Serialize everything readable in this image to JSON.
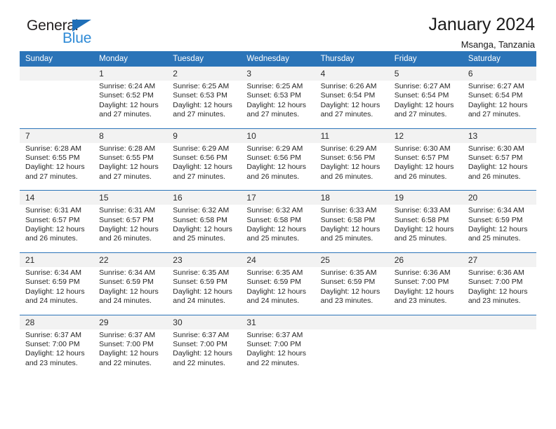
{
  "brand": {
    "name_part1": "General",
    "name_part2": "Blue",
    "triangle_icon": "triangle-icon",
    "accent_black": "#231f20",
    "accent_blue": "#2e8ad6"
  },
  "header": {
    "title": "January 2024",
    "subtitle": "Msanga, Tanzania"
  },
  "theme": {
    "header_blue": "#2b74b8",
    "daynum_band": "#f2f2f2",
    "text": "#262626"
  },
  "weekday_headers": [
    "Sunday",
    "Monday",
    "Tuesday",
    "Wednesday",
    "Thursday",
    "Friday",
    "Saturday"
  ],
  "weeks": [
    {
      "days": [
        {
          "num": "",
          "sunrise": "",
          "sunset": "",
          "daylight_line1": "",
          "daylight_line2": "",
          "empty": true
        },
        {
          "num": "1",
          "sunrise": "Sunrise: 6:24 AM",
          "sunset": "Sunset: 6:52 PM",
          "daylight_line1": "Daylight: 12 hours",
          "daylight_line2": "and 27 minutes.",
          "empty": false
        },
        {
          "num": "2",
          "sunrise": "Sunrise: 6:25 AM",
          "sunset": "Sunset: 6:53 PM",
          "daylight_line1": "Daylight: 12 hours",
          "daylight_line2": "and 27 minutes.",
          "empty": false
        },
        {
          "num": "3",
          "sunrise": "Sunrise: 6:25 AM",
          "sunset": "Sunset: 6:53 PM",
          "daylight_line1": "Daylight: 12 hours",
          "daylight_line2": "and 27 minutes.",
          "empty": false
        },
        {
          "num": "4",
          "sunrise": "Sunrise: 6:26 AM",
          "sunset": "Sunset: 6:54 PM",
          "daylight_line1": "Daylight: 12 hours",
          "daylight_line2": "and 27 minutes.",
          "empty": false
        },
        {
          "num": "5",
          "sunrise": "Sunrise: 6:27 AM",
          "sunset": "Sunset: 6:54 PM",
          "daylight_line1": "Daylight: 12 hours",
          "daylight_line2": "and 27 minutes.",
          "empty": false
        },
        {
          "num": "6",
          "sunrise": "Sunrise: 6:27 AM",
          "sunset": "Sunset: 6:54 PM",
          "daylight_line1": "Daylight: 12 hours",
          "daylight_line2": "and 27 minutes.",
          "empty": false
        }
      ]
    },
    {
      "days": [
        {
          "num": "7",
          "sunrise": "Sunrise: 6:28 AM",
          "sunset": "Sunset: 6:55 PM",
          "daylight_line1": "Daylight: 12 hours",
          "daylight_line2": "and 27 minutes.",
          "empty": false
        },
        {
          "num": "8",
          "sunrise": "Sunrise: 6:28 AM",
          "sunset": "Sunset: 6:55 PM",
          "daylight_line1": "Daylight: 12 hours",
          "daylight_line2": "and 27 minutes.",
          "empty": false
        },
        {
          "num": "9",
          "sunrise": "Sunrise: 6:29 AM",
          "sunset": "Sunset: 6:56 PM",
          "daylight_line1": "Daylight: 12 hours",
          "daylight_line2": "and 27 minutes.",
          "empty": false
        },
        {
          "num": "10",
          "sunrise": "Sunrise: 6:29 AM",
          "sunset": "Sunset: 6:56 PM",
          "daylight_line1": "Daylight: 12 hours",
          "daylight_line2": "and 26 minutes.",
          "empty": false
        },
        {
          "num": "11",
          "sunrise": "Sunrise: 6:29 AM",
          "sunset": "Sunset: 6:56 PM",
          "daylight_line1": "Daylight: 12 hours",
          "daylight_line2": "and 26 minutes.",
          "empty": false
        },
        {
          "num": "12",
          "sunrise": "Sunrise: 6:30 AM",
          "sunset": "Sunset: 6:57 PM",
          "daylight_line1": "Daylight: 12 hours",
          "daylight_line2": "and 26 minutes.",
          "empty": false
        },
        {
          "num": "13",
          "sunrise": "Sunrise: 6:30 AM",
          "sunset": "Sunset: 6:57 PM",
          "daylight_line1": "Daylight: 12 hours",
          "daylight_line2": "and 26 minutes.",
          "empty": false
        }
      ]
    },
    {
      "days": [
        {
          "num": "14",
          "sunrise": "Sunrise: 6:31 AM",
          "sunset": "Sunset: 6:57 PM",
          "daylight_line1": "Daylight: 12 hours",
          "daylight_line2": "and 26 minutes.",
          "empty": false
        },
        {
          "num": "15",
          "sunrise": "Sunrise: 6:31 AM",
          "sunset": "Sunset: 6:57 PM",
          "daylight_line1": "Daylight: 12 hours",
          "daylight_line2": "and 26 minutes.",
          "empty": false
        },
        {
          "num": "16",
          "sunrise": "Sunrise: 6:32 AM",
          "sunset": "Sunset: 6:58 PM",
          "daylight_line1": "Daylight: 12 hours",
          "daylight_line2": "and 25 minutes.",
          "empty": false
        },
        {
          "num": "17",
          "sunrise": "Sunrise: 6:32 AM",
          "sunset": "Sunset: 6:58 PM",
          "daylight_line1": "Daylight: 12 hours",
          "daylight_line2": "and 25 minutes.",
          "empty": false
        },
        {
          "num": "18",
          "sunrise": "Sunrise: 6:33 AM",
          "sunset": "Sunset: 6:58 PM",
          "daylight_line1": "Daylight: 12 hours",
          "daylight_line2": "and 25 minutes.",
          "empty": false
        },
        {
          "num": "19",
          "sunrise": "Sunrise: 6:33 AM",
          "sunset": "Sunset: 6:58 PM",
          "daylight_line1": "Daylight: 12 hours",
          "daylight_line2": "and 25 minutes.",
          "empty": false
        },
        {
          "num": "20",
          "sunrise": "Sunrise: 6:34 AM",
          "sunset": "Sunset: 6:59 PM",
          "daylight_line1": "Daylight: 12 hours",
          "daylight_line2": "and 25 minutes.",
          "empty": false
        }
      ]
    },
    {
      "days": [
        {
          "num": "21",
          "sunrise": "Sunrise: 6:34 AM",
          "sunset": "Sunset: 6:59 PM",
          "daylight_line1": "Daylight: 12 hours",
          "daylight_line2": "and 24 minutes.",
          "empty": false
        },
        {
          "num": "22",
          "sunrise": "Sunrise: 6:34 AM",
          "sunset": "Sunset: 6:59 PM",
          "daylight_line1": "Daylight: 12 hours",
          "daylight_line2": "and 24 minutes.",
          "empty": false
        },
        {
          "num": "23",
          "sunrise": "Sunrise: 6:35 AM",
          "sunset": "Sunset: 6:59 PM",
          "daylight_line1": "Daylight: 12 hours",
          "daylight_line2": "and 24 minutes.",
          "empty": false
        },
        {
          "num": "24",
          "sunrise": "Sunrise: 6:35 AM",
          "sunset": "Sunset: 6:59 PM",
          "daylight_line1": "Daylight: 12 hours",
          "daylight_line2": "and 24 minutes.",
          "empty": false
        },
        {
          "num": "25",
          "sunrise": "Sunrise: 6:35 AM",
          "sunset": "Sunset: 6:59 PM",
          "daylight_line1": "Daylight: 12 hours",
          "daylight_line2": "and 23 minutes.",
          "empty": false
        },
        {
          "num": "26",
          "sunrise": "Sunrise: 6:36 AM",
          "sunset": "Sunset: 7:00 PM",
          "daylight_line1": "Daylight: 12 hours",
          "daylight_line2": "and 23 minutes.",
          "empty": false
        },
        {
          "num": "27",
          "sunrise": "Sunrise: 6:36 AM",
          "sunset": "Sunset: 7:00 PM",
          "daylight_line1": "Daylight: 12 hours",
          "daylight_line2": "and 23 minutes.",
          "empty": false
        }
      ]
    },
    {
      "days": [
        {
          "num": "28",
          "sunrise": "Sunrise: 6:37 AM",
          "sunset": "Sunset: 7:00 PM",
          "daylight_line1": "Daylight: 12 hours",
          "daylight_line2": "and 23 minutes.",
          "empty": false
        },
        {
          "num": "29",
          "sunrise": "Sunrise: 6:37 AM",
          "sunset": "Sunset: 7:00 PM",
          "daylight_line1": "Daylight: 12 hours",
          "daylight_line2": "and 22 minutes.",
          "empty": false
        },
        {
          "num": "30",
          "sunrise": "Sunrise: 6:37 AM",
          "sunset": "Sunset: 7:00 PM",
          "daylight_line1": "Daylight: 12 hours",
          "daylight_line2": "and 22 minutes.",
          "empty": false
        },
        {
          "num": "31",
          "sunrise": "Sunrise: 6:37 AM",
          "sunset": "Sunset: 7:00 PM",
          "daylight_line1": "Daylight: 12 hours",
          "daylight_line2": "and 22 minutes.",
          "empty": false
        },
        {
          "num": "",
          "sunrise": "",
          "sunset": "",
          "daylight_line1": "",
          "daylight_line2": "",
          "empty": true
        },
        {
          "num": "",
          "sunrise": "",
          "sunset": "",
          "daylight_line1": "",
          "daylight_line2": "",
          "empty": true
        },
        {
          "num": "",
          "sunrise": "",
          "sunset": "",
          "daylight_line1": "",
          "daylight_line2": "",
          "empty": true
        }
      ]
    }
  ]
}
